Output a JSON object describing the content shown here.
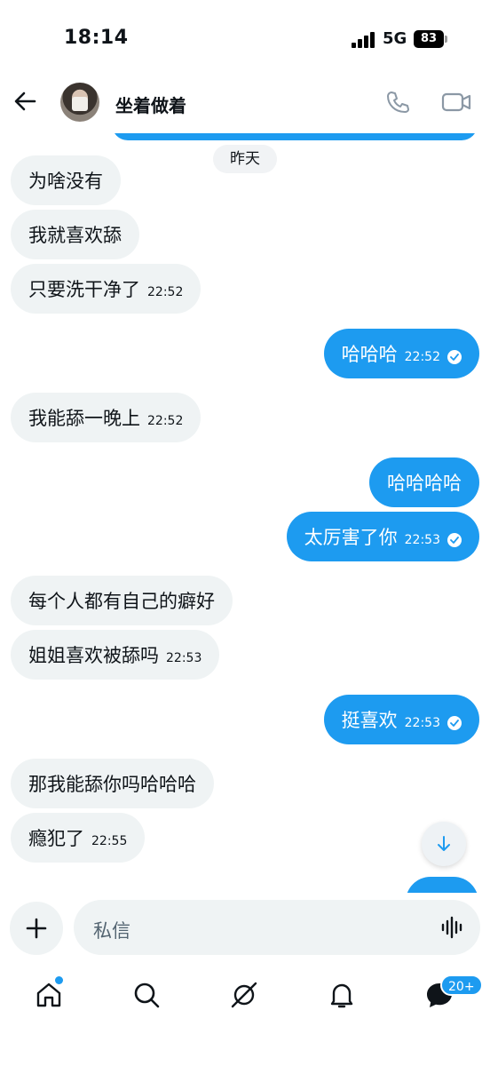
{
  "status_bar": {
    "time": "18:14",
    "network": "5G",
    "battery": "83"
  },
  "header": {
    "contact_name": "坐着做着",
    "back_icon": "arrow-left-icon",
    "call_icon": "phone-icon",
    "video_icon": "video-camera-icon"
  },
  "conversation": {
    "date_separator": "昨天",
    "messages": [
      {
        "direction": "in",
        "text": "为啥没有",
        "time": ""
      },
      {
        "direction": "in",
        "text": "我就喜欢舔",
        "time": ""
      },
      {
        "direction": "in",
        "text": "只要洗干净了",
        "time": "22:52"
      },
      {
        "direction": "out",
        "text": "哈哈哈",
        "time": "22:52",
        "read": true
      },
      {
        "direction": "in",
        "text": "我能舔一晚上",
        "time": "22:52"
      },
      {
        "direction": "out",
        "text": "哈哈哈哈",
        "time": ""
      },
      {
        "direction": "out",
        "text": "太厉害了你",
        "time": "22:53",
        "read": true
      },
      {
        "direction": "in",
        "text": "每个人都有自己的癖好",
        "time": ""
      },
      {
        "direction": "in",
        "text": "姐姐喜欢被舔吗",
        "time": "22:53"
      },
      {
        "direction": "out",
        "text": "挺喜欢",
        "time": "22:53",
        "read": true
      },
      {
        "direction": "in",
        "text": "那我能舔你吗哈哈哈",
        "time": ""
      },
      {
        "direction": "in",
        "text": "瘾犯了",
        "time": "22:55"
      }
    ]
  },
  "composer": {
    "placeholder": "私信",
    "add_icon": "plus-icon",
    "voice_icon": "voice-waveform-icon"
  },
  "bottom_nav": {
    "items": [
      "home-icon",
      "search-icon",
      "grok-icon",
      "bell-icon",
      "messages-icon"
    ],
    "messages_badge": "20+"
  },
  "colors": {
    "accent": "#1d9bf0",
    "incoming_bubble": "#eff3f4",
    "text": "#0f1419",
    "muted": "#536471"
  }
}
